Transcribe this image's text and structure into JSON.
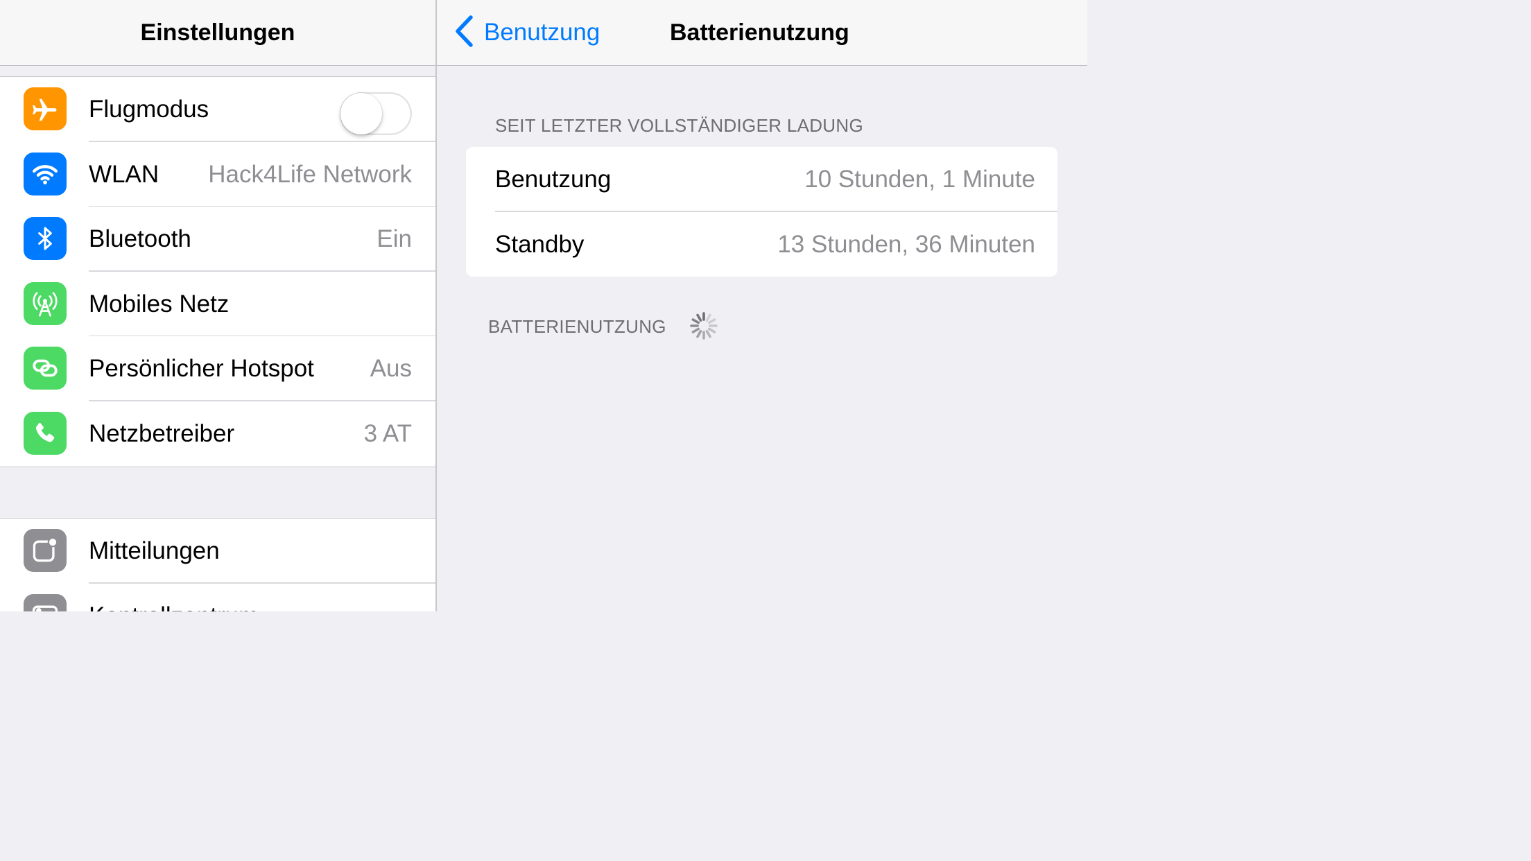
{
  "left_pane": {
    "title": "Einstellungen",
    "group1": [
      {
        "label": "Flugmodus",
        "icon": "airplane-icon",
        "icon_color": "#ff9500",
        "toggle": false
      },
      {
        "label": "WLAN",
        "value": "Hack4Life Network",
        "icon": "wifi-icon",
        "icon_color": "#007aff"
      },
      {
        "label": "Bluetooth",
        "value": "Ein",
        "icon": "bluetooth-icon",
        "icon_color": "#007aff"
      },
      {
        "label": "Mobiles Netz",
        "value": "",
        "icon": "cellular-antenna-icon",
        "icon_color": "#4cd964"
      },
      {
        "label": "Persönlicher Hotspot",
        "value": "Aus",
        "icon": "hotspot-chain-icon",
        "icon_color": "#4cd964"
      },
      {
        "label": "Netzbetreiber",
        "value": "3 AT",
        "icon": "phone-icon",
        "icon_color": "#4cd964"
      }
    ],
    "group2": [
      {
        "label": "Mitteilungen",
        "icon": "notifications-icon",
        "icon_color": "#8e8e93"
      },
      {
        "label": "Kontrollzentrum",
        "icon": "control-center-icon",
        "icon_color": "#8e8e93"
      }
    ]
  },
  "right_pane": {
    "back_label": "Benutzung",
    "title": "Batterienutzung",
    "section1_header": "SEIT LETZTER VOLLSTÄNDIGER LADUNG",
    "rows": [
      {
        "label": "Benutzung",
        "value": "10 Stunden, 1 Minute"
      },
      {
        "label": "Standby",
        "value": "13 Stunden, 36 Minuten"
      }
    ],
    "section2_header": "BATTERIENUTZUNG",
    "loading": true
  },
  "colors": {
    "accent": "#007aff",
    "background": "#efeff4",
    "secondary_text": "#8e8e93"
  }
}
